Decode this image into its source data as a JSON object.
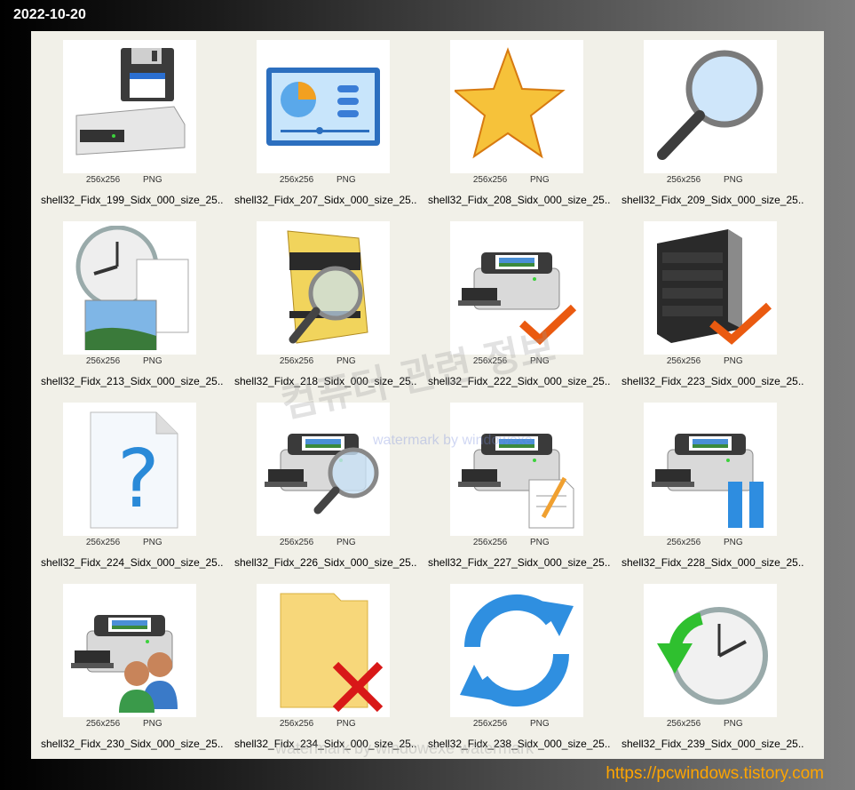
{
  "date": "2022-10-20",
  "footer_url": "https://pcwindows.tistory.com",
  "watermark": {
    "korean": "컴퓨터 관련 정보",
    "english": "watermark by windowexe",
    "bottom": "watermark by windowexe watermark"
  },
  "icons": [
    {
      "name": "shell32_Fidx_199_Sidx_000_size_25...",
      "size": "256x256",
      "format": "PNG",
      "icon": "drive-floppy-icon"
    },
    {
      "name": "shell32_Fidx_207_Sidx_000_size_25...",
      "size": "256x256",
      "format": "PNG",
      "icon": "control-panel-icon"
    },
    {
      "name": "shell32_Fidx_208_Sidx_000_size_25...",
      "size": "256x256",
      "format": "PNG",
      "icon": "star-icon"
    },
    {
      "name": "shell32_Fidx_209_Sidx_000_size_25...",
      "size": "256x256",
      "format": "PNG",
      "icon": "magnifier-icon"
    },
    {
      "name": "shell32_Fidx_213_Sidx_000_size_25...",
      "size": "256x256",
      "format": "PNG",
      "icon": "clock-documents-icon"
    },
    {
      "name": "shell32_Fidx_218_Sidx_000_size_25...",
      "size": "256x256",
      "format": "PNG",
      "icon": "book-search-icon"
    },
    {
      "name": "shell32_Fidx_222_Sidx_000_size_25...",
      "size": "256x256",
      "format": "PNG",
      "icon": "printer-check-icon"
    },
    {
      "name": "shell32_Fidx_223_Sidx_000_size_25...",
      "size": "256x256",
      "format": "PNG",
      "icon": "server-check-icon"
    },
    {
      "name": "shell32_Fidx_224_Sidx_000_size_25...",
      "size": "256x256",
      "format": "PNG",
      "icon": "unknown-file-icon"
    },
    {
      "name": "shell32_Fidx_226_Sidx_000_size_25...",
      "size": "256x256",
      "format": "PNG",
      "icon": "printer-search-icon"
    },
    {
      "name": "shell32_Fidx_227_Sidx_000_size_25...",
      "size": "256x256",
      "format": "PNG",
      "icon": "printer-document-icon"
    },
    {
      "name": "shell32_Fidx_228_Sidx_000_size_25...",
      "size": "256x256",
      "format": "PNG",
      "icon": "printer-pause-icon"
    },
    {
      "name": "shell32_Fidx_230_Sidx_000_size_25...",
      "size": "256x256",
      "format": "PNG",
      "icon": "printer-users-icon"
    },
    {
      "name": "shell32_Fidx_234_Sidx_000_size_25...",
      "size": "256x256",
      "format": "PNG",
      "icon": "folder-delete-icon"
    },
    {
      "name": "shell32_Fidx_238_Sidx_000_size_25...",
      "size": "256x256",
      "format": "PNG",
      "icon": "refresh-arrows-icon"
    },
    {
      "name": "shell32_Fidx_239_Sidx_000_size_25...",
      "size": "256x256",
      "format": "PNG",
      "icon": "clock-back-icon"
    }
  ]
}
